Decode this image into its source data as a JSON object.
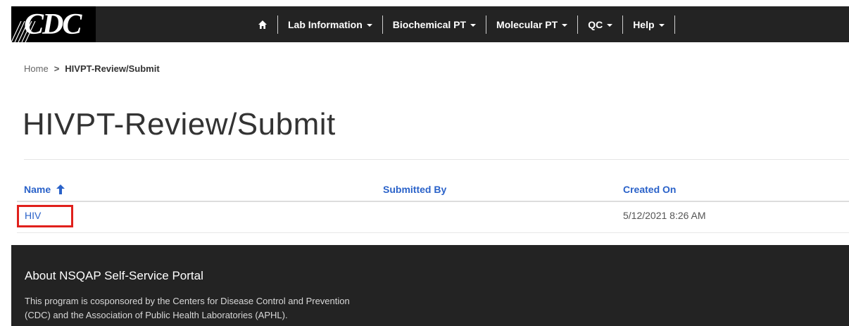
{
  "header": {
    "logo_text": "CDC",
    "nav": [
      {
        "label": "Lab Information"
      },
      {
        "label": "Biochemical PT"
      },
      {
        "label": "Molecular PT"
      },
      {
        "label": "QC"
      },
      {
        "label": "Help"
      }
    ]
  },
  "breadcrumb": {
    "home": "Home",
    "separator": ">",
    "current": "HIVPT-Review/Submit"
  },
  "page": {
    "title": "HIVPT-Review/Submit"
  },
  "table": {
    "columns": [
      "Name",
      "Submitted By",
      "Created On"
    ],
    "sort_icon": "arrow-up-icon",
    "rows": [
      {
        "name": "HIV",
        "submitted_by": "",
        "created_on": "5/12/2021 8:26 AM"
      }
    ]
  },
  "footer": {
    "title": "About NSQAP Self-Service Portal",
    "text_line1": "This program is cosponsored by the Centers for Disease Control and Prevention",
    "text_line2": "(CDC) and the Association of Public Health Laboratories (APHL)."
  },
  "colors": {
    "nav_bg": "#232323",
    "link": "#2a62c9",
    "highlight": "#e0201c"
  }
}
